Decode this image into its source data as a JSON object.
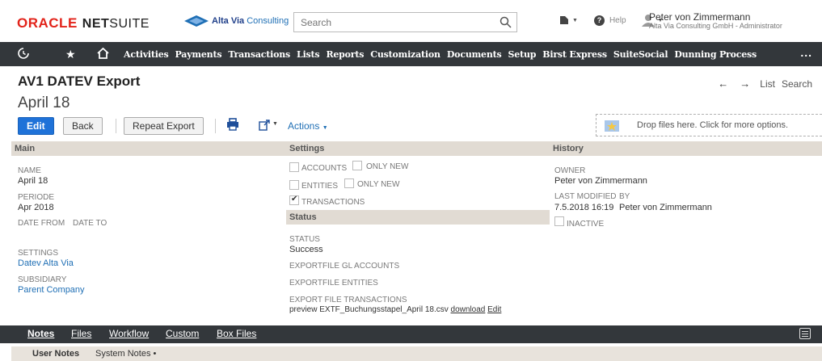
{
  "header": {
    "oracle": "ORACLE",
    "netsuite_bold": "NET",
    "netsuite_rest": "SUITE",
    "company_name_bold": "Alta Via",
    "company_name_rest": " Consulting",
    "search_placeholder": "Search",
    "help_label": "Help",
    "user_name": "Peter von Zimmermann",
    "user_role": "Alta Via Consulting GmbH - Administrator"
  },
  "nav": {
    "items": [
      "Activities",
      "Payments",
      "Transactions",
      "Lists",
      "Reports",
      "Customization",
      "Documents",
      "Setup",
      "Birst Express",
      "SuiteSocial",
      "Dunning Process"
    ],
    "active": "Transactions",
    "more": "..."
  },
  "page": {
    "title": "AV1 DATEV Export",
    "record_name": "April 18",
    "list_label": "List",
    "search_label": "Search"
  },
  "buttons": {
    "edit": "Edit",
    "back": "Back",
    "repeat_export": "Repeat Export",
    "actions": "Actions"
  },
  "drop_zone": {
    "text": "Drop files here. Click for more options."
  },
  "sections": {
    "main": "Main",
    "settings": "Settings",
    "status": "Status",
    "history": "History"
  },
  "main_fields": {
    "name_label": "NAME",
    "name_value": "April 18",
    "periode_label": "PERIODE",
    "periode_value": "Apr 2018",
    "date_from_label": "DATE FROM",
    "date_to_label": "DATE TO",
    "settings_label": "SETTINGS",
    "settings_value": "Datev Alta Via",
    "subsidiary_label": "SUBSIDIARY",
    "subsidiary_value": "Parent Company"
  },
  "settings_fields": {
    "accounts": "ACCOUNTS",
    "accounts_only_new": "ONLY NEW",
    "entities": "ENTITIES",
    "entities_only_new": "ONLY NEW",
    "transactions": "TRANSACTIONS"
  },
  "status_fields": {
    "status_label": "STATUS",
    "status_value": "Success",
    "gl_accounts_label": "EXPORTFILE GL ACCOUNTS",
    "entities_label": "EXPORTFILE ENTITIES",
    "transactions_label": "EXPORT FILE TRANSACTIONS",
    "preview_text": "preview EXTF_Buchungsstapel_April 18.csv",
    "download_link": "download",
    "edit_link": "Edit"
  },
  "history_fields": {
    "owner_label": "OWNER",
    "owner_value": "Peter von Zimmermann",
    "last_modified_label": "LAST MODIFIED",
    "by_label": "BY",
    "last_modified_value": "7.5.2018 16:19",
    "by_value": "Peter von Zimmermann",
    "inactive_label": "INACTIVE"
  },
  "subtabs": [
    "Notes",
    "Files",
    "Workflow",
    "Custom",
    "Box Files"
  ],
  "notes_tabs": {
    "user_notes": "User Notes",
    "system_notes": "System Notes •"
  },
  "colors": {
    "nav_bg": "#33373b",
    "section_bg": "#e1dbd3",
    "primary_button": "#1f72d8",
    "oracle_red": "#e2231a"
  }
}
